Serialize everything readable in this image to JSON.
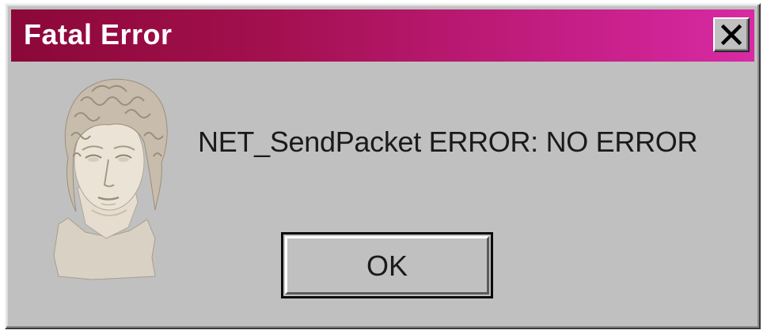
{
  "dialog": {
    "title": "Fatal Error",
    "message": "NET_SendPacket ERROR: NO ERROR",
    "ok_label": "OK",
    "close_icon": "close-x-icon",
    "icon": "classical-bust-statue"
  },
  "colors": {
    "titlebar_start": "#8b0838",
    "titlebar_end": "#d82aa4",
    "window_bg": "#c0c0c0",
    "title_text": "#ffffff",
    "message_text": "#1a1a1a"
  }
}
